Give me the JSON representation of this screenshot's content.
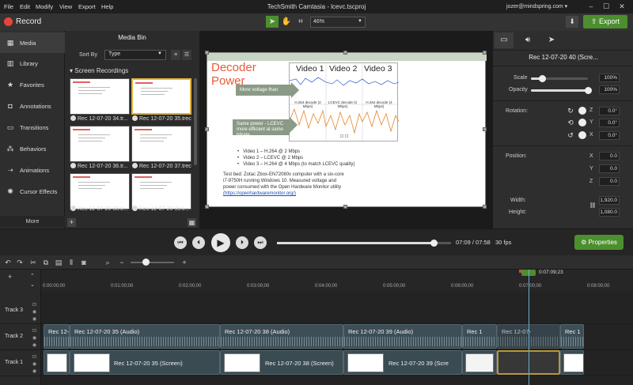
{
  "menu": {
    "items": [
      "File",
      "Edit",
      "Modify",
      "View",
      "Export",
      "Help"
    ],
    "app_title": "TechSmith Camtasia - lcevc.tscproj",
    "user": "jozer@mindspring.com ▾"
  },
  "toolbar": {
    "record_label": "Record",
    "zoom": "46%",
    "export_label": "Export"
  },
  "nav": {
    "items": [
      {
        "label": "Media",
        "icon": "film-icon"
      },
      {
        "label": "Library",
        "icon": "library-icon"
      },
      {
        "label": "Favorites",
        "icon": "star-icon"
      },
      {
        "label": "Annotations",
        "icon": "annotation-icon"
      },
      {
        "label": "Transitions",
        "icon": "transition-icon"
      },
      {
        "label": "Behaviors",
        "icon": "behavior-icon"
      },
      {
        "label": "Animations",
        "icon": "animation-icon"
      },
      {
        "label": "Cursor Effects",
        "icon": "cursor-icon"
      }
    ],
    "more": "More"
  },
  "media_bin": {
    "title": "Media Bin",
    "sort_by_label": "Sort By",
    "sort_value": "Type",
    "section": "Screen Recordings",
    "thumbs": [
      {
        "label": "Rec 12-07-20 34.tr..."
      },
      {
        "label": "Rec 12-07-20 35.trec"
      },
      {
        "label": "Rec 12-07-20 36.tr..."
      },
      {
        "label": "Rec 12-07-20 37.trec"
      },
      {
        "label": "Rec 12-07-20 38.tr..."
      },
      {
        "label": "Rec 12-07-20 39.tr..."
      }
    ]
  },
  "canvas": {
    "title_line1": "Decoder",
    "title_line2": "Power",
    "arrow1": "More voltage than LCEVC",
    "arrow2": "Same power - LCEVC more efficient at same bitrate",
    "chart_titles": [
      "Video 1",
      "Video 2",
      "Video 3"
    ],
    "chart_sublabels": [
      "H.264 decode (2 Mbps)",
      "LCEVC decode (2 Mbps)",
      "H.264 decode (4 Mbps)"
    ],
    "bullets": [
      "Video 1 – H.264 @ 2 Mbps",
      "Video 2 – LCEVC @ 2 Mbps",
      "Video 3 – H.264 @ 4 Mbps (to match LCEVC quality)"
    ],
    "testbed_1": "Test bed: Zotac Zbox-EN72080v computer with a six-core",
    "testbed_2": "i7-9750H running Windows 10. Measured voltage and",
    "testbed_3": "power consumed with the Open Hardware Monitor utility",
    "testbed_link": "(https://openhardwaremonitor.org/)"
  },
  "properties": {
    "title": "Rec 12-07-20 40 (Scre...",
    "scale_label": "Scale",
    "scale_value": "100%",
    "scale_fraction": 0.2,
    "opacity_label": "Opacity",
    "opacity_value": "100%",
    "opacity_fraction": 1.0,
    "rotation_label": "Rotation:",
    "rot_z": "0.0°",
    "rot_y": "0.0°",
    "rot_x": "0.0°",
    "position_label": "Position:",
    "pos_x": "0.0",
    "pos_y": "0.0",
    "pos_z": "0.0",
    "width_label": "Width:",
    "width_value": "1,920.0",
    "height_label": "Height:",
    "height_value": "1,080.0",
    "axis_x": "X",
    "axis_y": "Y",
    "axis_z": "Z"
  },
  "playback": {
    "time": "07:09 / 07:58",
    "fps": "30 fps",
    "properties_label": "Properties",
    "progress_fraction": 0.9
  },
  "timeline": {
    "ticks": [
      "0:00:00;00",
      "0:01:00;00",
      "0:02:00;00",
      "0:03:00;00",
      "0:04:00;00",
      "0:05:00;00",
      "0:06:00;00",
      "0:07:00;00",
      "0:08:00;00"
    ],
    "playhead_time": "0:07:09;23",
    "tracks": [
      "Track 3",
      "Track 2",
      "Track 1"
    ],
    "track2_clips": [
      "Rec 12-",
      "Rec 12-07-20 35 (Audio)",
      "Rec 12-07-20 38 (Audio)",
      "Rec 12-07-20 39 (Audio)",
      "Rec 1",
      "Rec 12-07-",
      "Rec 1"
    ],
    "track1_clips": [
      "Rec 12-07-20 35 (Screen)",
      "Rec 12-07-20 38 (Screen)",
      "Rec 12-07-20 39 (Scre"
    ]
  }
}
